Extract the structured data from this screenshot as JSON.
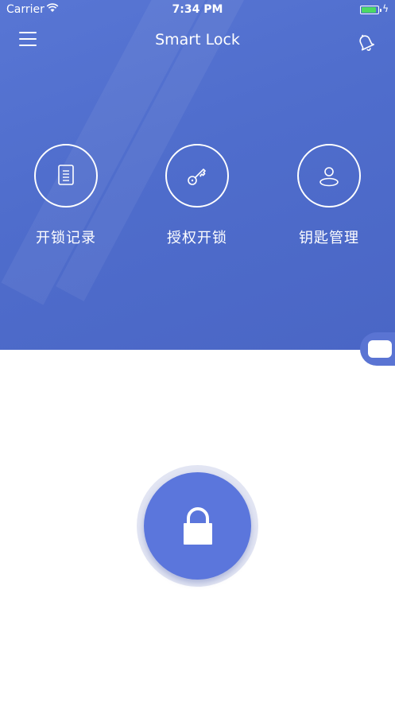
{
  "status_bar": {
    "carrier": "Carrier",
    "time": "7:34 PM"
  },
  "nav": {
    "title": "Smart Lock"
  },
  "features": [
    {
      "label": "开锁记录",
      "icon": "document-icon"
    },
    {
      "label": "授权开锁",
      "icon": "key-icon"
    },
    {
      "label": "钥匙管理",
      "icon": "user-icon"
    }
  ],
  "colors": {
    "primary": "#4f6dcc",
    "button": "#5b76dc",
    "battery": "#4cd964"
  }
}
